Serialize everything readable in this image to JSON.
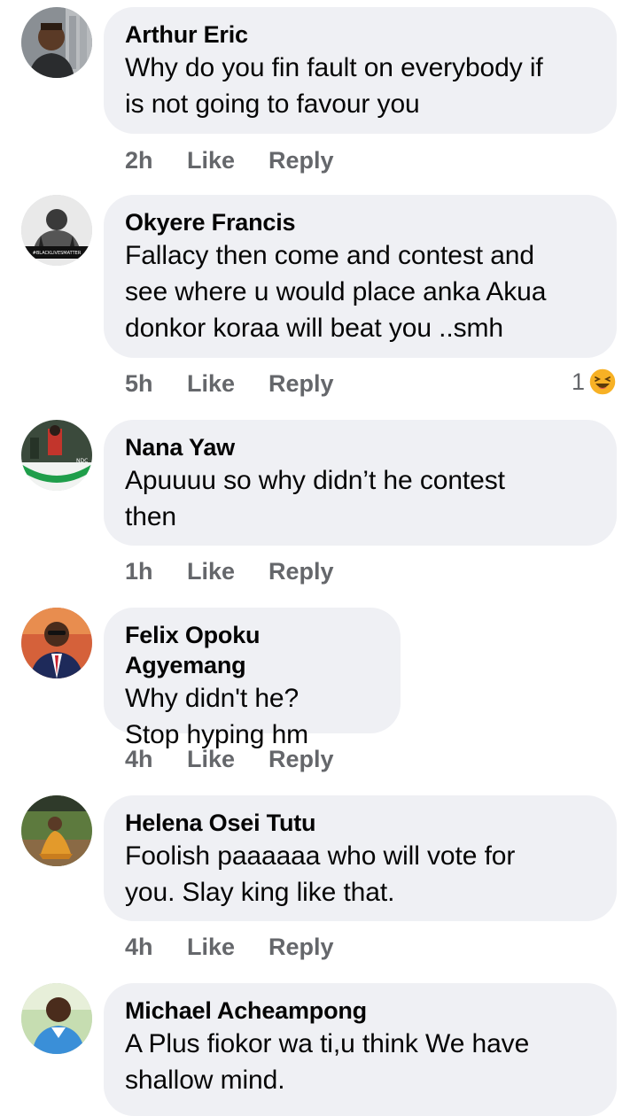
{
  "comments": [
    {
      "author": "Arthur Eric",
      "text": "Why do you fin fault on everybody if\nis not going to favour you",
      "time": "2h",
      "like_label": "Like",
      "reply_label": "Reply"
    },
    {
      "author": "Okyere Francis",
      "text": "Fallacy then come and contest and\nsee  where u would place anka Akua\ndonkor koraa will beat you ..smh",
      "time": "5h",
      "like_label": "Like",
      "reply_label": "Reply",
      "reaction_count": "1",
      "reaction_icon": "laughing-emoji-icon",
      "avatar_caption": "#BLACKLIVESMATTER"
    },
    {
      "author": "Nana Yaw",
      "text": "Apuuuu so why didn’t he contest\nthen",
      "time": "1h",
      "like_label": "Like",
      "reply_label": "Reply"
    },
    {
      "author": "Felix Opoku Agyemang",
      "text": "Why didn't he?\nStop hyping hm",
      "time": "4h",
      "like_label": "Like",
      "reply_label": "Reply"
    },
    {
      "author": "Helena Osei Tutu",
      "text": "Foolish paaaaaa who will vote for\nyou. Slay king like that.",
      "time": "4h",
      "like_label": "Like",
      "reply_label": "Reply"
    },
    {
      "author": "Michael Acheampong",
      "text": "A Plus fiokor wa ti,u think We have\nshallow mind.",
      "time": "",
      "like_label": "",
      "reply_label": ""
    }
  ],
  "colors": {
    "bubble_bg": "#eff0f4",
    "meta_text": "#65676b",
    "body_text": "#050505"
  }
}
